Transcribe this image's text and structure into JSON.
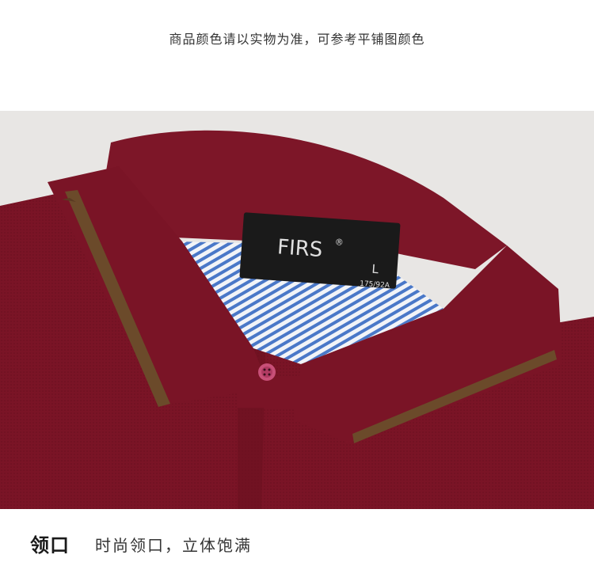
{
  "notice": "商品颜色请以实物为准，可参考平铺图颜色",
  "label": {
    "brand": "FIRS",
    "registered": "®",
    "size": "L",
    "size_code": "175/92A"
  },
  "caption": {
    "title": "领口",
    "description": "时尚领口，立体饱满"
  },
  "colors": {
    "shirt": "#7a1426",
    "collar_stripe": "#6b4a2a",
    "lining_stripe_blue": "#4a78c8",
    "background": "#e8e6e4",
    "button": "#c85078"
  }
}
